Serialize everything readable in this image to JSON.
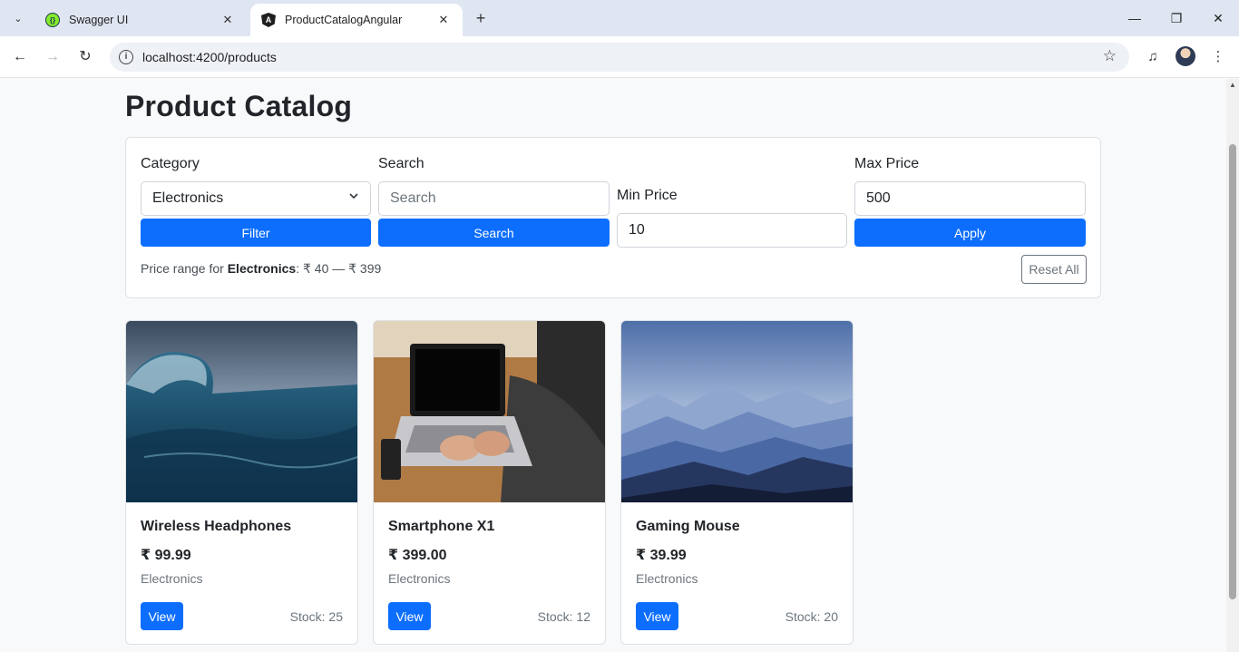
{
  "browser": {
    "tabs": [
      {
        "title": "Swagger UI",
        "icon": "swagger-icon",
        "active": false
      },
      {
        "title": "ProductCatalogAngular",
        "icon": "angular-icon",
        "active": true
      }
    ],
    "url": "localhost:4200/products"
  },
  "page": {
    "title": "Product Catalog"
  },
  "filters": {
    "category": {
      "label": "Category",
      "value": "Electronics",
      "button": "Filter"
    },
    "search": {
      "label": "Search",
      "placeholder": "Search",
      "button": "Search"
    },
    "min_price": {
      "label": "Min Price",
      "value": "10"
    },
    "max_price": {
      "label": "Max Price",
      "value": "500",
      "button": "Apply"
    },
    "range": {
      "prefix": "Price range for ",
      "category": "Electronics",
      "suffix": ": ₹ 40 — ₹ 399"
    },
    "reset_label": "Reset All"
  },
  "products": [
    {
      "name": "Wireless Headphones",
      "price": "₹ 99.99",
      "category": "Electronics",
      "view": "View",
      "stock": "Stock: 25",
      "image": "ocean-wave"
    },
    {
      "name": "Smartphone X1",
      "price": "₹ 399.00",
      "category": "Electronics",
      "view": "View",
      "stock": "Stock: 12",
      "image": "laptop-on-desk"
    },
    {
      "name": "Gaming Mouse",
      "price": "₹ 39.99",
      "category": "Electronics",
      "view": "View",
      "stock": "Stock: 20",
      "image": "misty-mountains"
    }
  ],
  "colors": {
    "primary": "#0d6efd",
    "page_bg": "#f8f9fa",
    "tabbar_bg": "#dfe6f2"
  }
}
